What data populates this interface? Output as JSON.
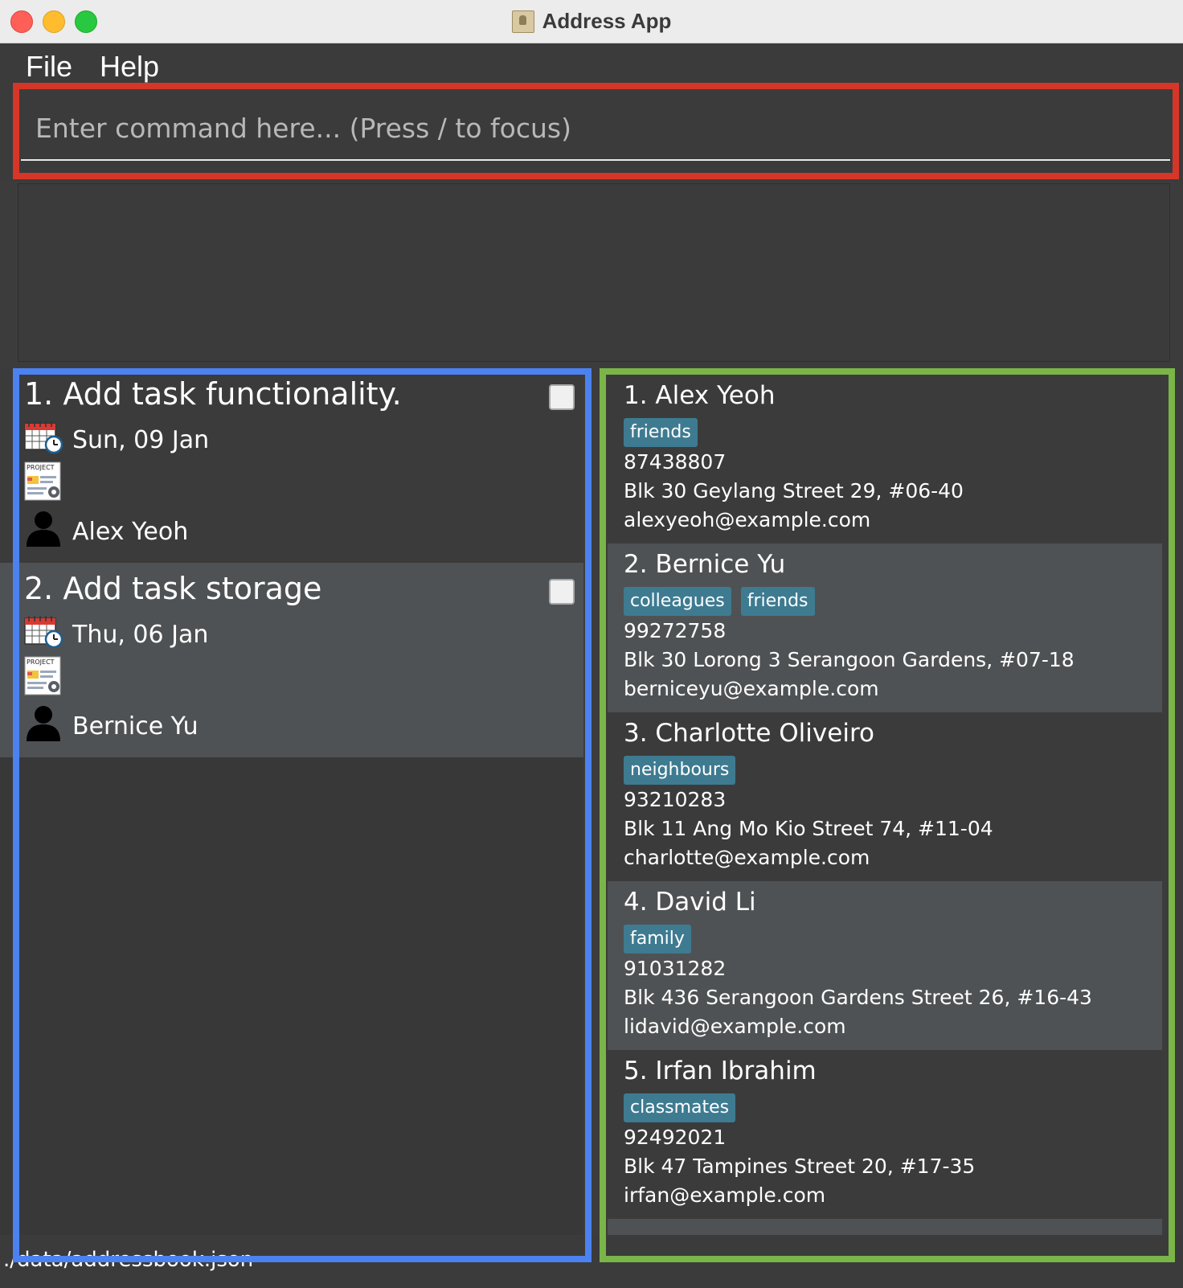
{
  "window": {
    "title": "Address App"
  },
  "menu": {
    "file": "File",
    "help": "Help"
  },
  "command": {
    "placeholder": "Enter command here... (Press / to focus)",
    "value": ""
  },
  "result": {
    "text": ""
  },
  "tasks": [
    {
      "title": "1. Add task functionality.",
      "date": "Sun, 09 Jan",
      "assignee": "Alex Yeoh",
      "done": false
    },
    {
      "title": "2. Add task storage",
      "date": "Thu, 06 Jan",
      "assignee": "Bernice Yu",
      "done": false
    }
  ],
  "persons": [
    {
      "name": "1.  Alex Yeoh",
      "tags": [
        "friends"
      ],
      "phone": "87438807",
      "address": "Blk 30 Geylang Street 29, #06-40",
      "email": "alexyeoh@example.com"
    },
    {
      "name": "2.  Bernice Yu",
      "tags": [
        "colleagues",
        "friends"
      ],
      "phone": "99272758",
      "address": "Blk 30 Lorong 3 Serangoon Gardens, #07-18",
      "email": "berniceyu@example.com"
    },
    {
      "name": "3.  Charlotte Oliveiro",
      "tags": [
        "neighbours"
      ],
      "phone": "93210283",
      "address": "Blk 11 Ang Mo Kio Street 74, #11-04",
      "email": "charlotte@example.com"
    },
    {
      "name": "4.  David Li",
      "tags": [
        "family"
      ],
      "phone": "91031282",
      "address": "Blk 436 Serangoon Gardens Street 26, #16-43",
      "email": "lidavid@example.com"
    },
    {
      "name": "5.  Irfan Ibrahim",
      "tags": [
        "classmates"
      ],
      "phone": "92492021",
      "address": "Blk 47 Tampines Street 20, #17-35",
      "email": "irfan@example.com"
    }
  ],
  "status": {
    "path": "./data/addressbook.json"
  },
  "colors": {
    "highlight_command": "#d63628",
    "highlight_tasks": "#4c82f0",
    "highlight_persons": "#7ab548",
    "tag_bg": "#3e7b91"
  },
  "icons": {
    "task_date": "calendar-clock-icon",
    "task_project": "project-document-icon",
    "task_assignee": "person-icon"
  }
}
